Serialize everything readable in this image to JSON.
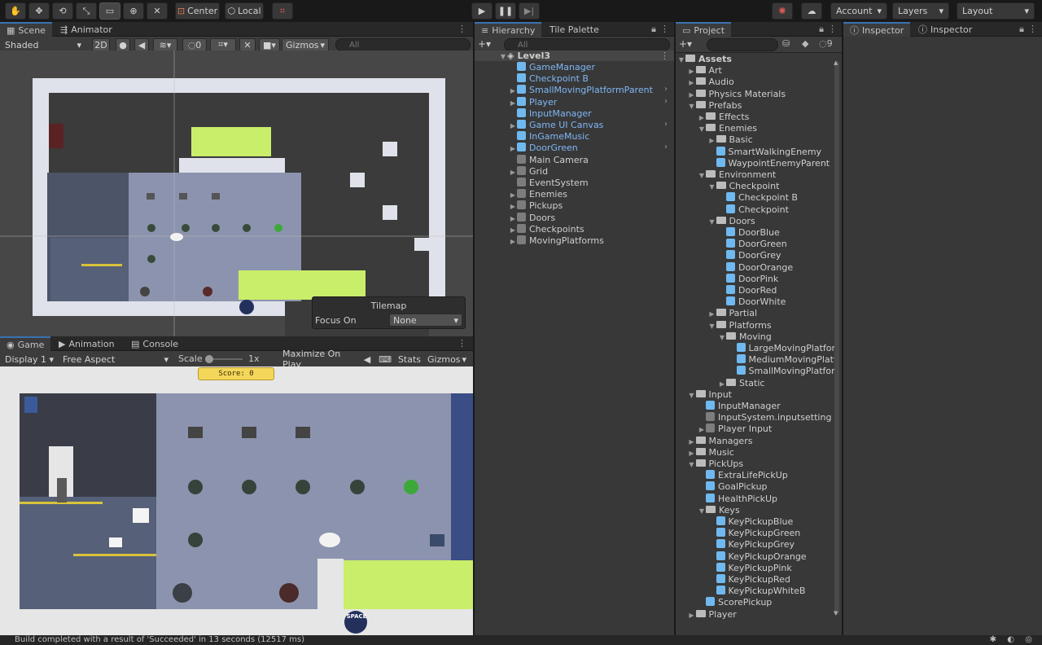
{
  "toolbar": {
    "center_label": "Center",
    "local_label": "Local",
    "account_label": "Account",
    "layers_label": "Layers",
    "layout_label": "Layout"
  },
  "scene": {
    "tabs": [
      "Scene",
      "Animator"
    ],
    "shading": "Shaded",
    "mode_2d": "2D",
    "hidden_count": "0",
    "gizmos": "Gizmos",
    "search_placeholder": "All",
    "overlay_title": "Tilemap",
    "focus_label": "Focus On",
    "focus_value": "None"
  },
  "game": {
    "tabs": [
      "Game",
      "Animation",
      "Console"
    ],
    "display": "Display 1",
    "aspect": "Free Aspect",
    "scale_label": "Scale",
    "scale_value": "1x",
    "maximize": "Maximize On Play",
    "stats": "Stats",
    "gizmos": "Gizmos",
    "score": "Score: 0",
    "badge": "SPACE"
  },
  "hierarchy": {
    "tabs": [
      "Hierarchy",
      "Tile Palette"
    ],
    "search_placeholder": "All",
    "root": "Level3",
    "items": [
      {
        "label": "GameManager",
        "blue": true,
        "arrow": false
      },
      {
        "label": "Checkpoint B",
        "blue": true,
        "arrow": false
      },
      {
        "label": "SmallMovingPlatformParent",
        "blue": true,
        "arrow": true
      },
      {
        "label": "Player",
        "blue": true,
        "arrow": true
      },
      {
        "label": "InputManager",
        "blue": true,
        "arrow": false
      },
      {
        "label": "Game UI Canvas",
        "blue": true,
        "arrow": true
      },
      {
        "label": "InGameMusic",
        "blue": true,
        "arrow": false
      },
      {
        "label": "DoorGreen",
        "blue": true,
        "arrow": true
      },
      {
        "label": "Main Camera",
        "blue": false,
        "arrow": false
      },
      {
        "label": "Grid",
        "blue": false,
        "arrow": true
      },
      {
        "label": "EventSystem",
        "blue": false,
        "arrow": false
      },
      {
        "label": "Enemies",
        "blue": false,
        "arrow": true
      },
      {
        "label": "Pickups",
        "blue": false,
        "arrow": true
      },
      {
        "label": "Doors",
        "blue": false,
        "arrow": true
      },
      {
        "label": "Checkpoints",
        "blue": false,
        "arrow": true
      },
      {
        "label": "MovingPlatforms",
        "blue": false,
        "arrow": true
      }
    ]
  },
  "project": {
    "tab": "Project",
    "hidden_count": "9",
    "items": [
      {
        "label": "Assets",
        "depth": 0,
        "type": "folder",
        "open": true
      },
      {
        "label": "Art",
        "depth": 1,
        "type": "folder",
        "open": false
      },
      {
        "label": "Audio",
        "depth": 1,
        "type": "folder",
        "open": false
      },
      {
        "label": "Physics Materials",
        "depth": 1,
        "type": "folder",
        "open": false
      },
      {
        "label": "Prefabs",
        "depth": 1,
        "type": "folder",
        "open": true
      },
      {
        "label": "Effects",
        "depth": 2,
        "type": "folder",
        "open": false
      },
      {
        "label": "Enemies",
        "depth": 2,
        "type": "folder",
        "open": true
      },
      {
        "label": "Basic",
        "depth": 3,
        "type": "folder",
        "open": false
      },
      {
        "label": "SmartWalkingEnemy",
        "depth": 3,
        "type": "prefab"
      },
      {
        "label": "WaypointEnemyParent",
        "depth": 3,
        "type": "prefab"
      },
      {
        "label": "Environment",
        "depth": 2,
        "type": "folder",
        "open": true
      },
      {
        "label": "Checkpoint",
        "depth": 3,
        "type": "folder",
        "open": true
      },
      {
        "label": "Checkpoint B",
        "depth": 4,
        "type": "prefab"
      },
      {
        "label": "Checkpoint",
        "depth": 4,
        "type": "prefab"
      },
      {
        "label": "Doors",
        "depth": 3,
        "type": "folder",
        "open": true
      },
      {
        "label": "DoorBlue",
        "depth": 4,
        "type": "prefab"
      },
      {
        "label": "DoorGreen",
        "depth": 4,
        "type": "prefab"
      },
      {
        "label": "DoorGrey",
        "depth": 4,
        "type": "prefab"
      },
      {
        "label": "DoorOrange",
        "depth": 4,
        "type": "prefab"
      },
      {
        "label": "DoorPink",
        "depth": 4,
        "type": "prefab"
      },
      {
        "label": "DoorRed",
        "depth": 4,
        "type": "prefab"
      },
      {
        "label": "DoorWhite",
        "depth": 4,
        "type": "prefab"
      },
      {
        "label": "Partial",
        "depth": 3,
        "type": "folder",
        "open": false
      },
      {
        "label": "Platforms",
        "depth": 3,
        "type": "folder",
        "open": true
      },
      {
        "label": "Moving",
        "depth": 4,
        "type": "folder",
        "open": true
      },
      {
        "label": "LargeMovingPlatfor",
        "depth": 5,
        "type": "prefab"
      },
      {
        "label": "MediumMovingPlatf",
        "depth": 5,
        "type": "prefab"
      },
      {
        "label": "SmallMovingPlatfon",
        "depth": 5,
        "type": "prefab"
      },
      {
        "label": "Static",
        "depth": 4,
        "type": "folder",
        "open": false
      },
      {
        "label": "Input",
        "depth": 1,
        "type": "folder",
        "open": true
      },
      {
        "label": "InputManager",
        "depth": 2,
        "type": "prefab"
      },
      {
        "label": "InputSystem.inputsetting",
        "depth": 2,
        "type": "asset"
      },
      {
        "label": "Player Input",
        "depth": 2,
        "type": "asset",
        "arrow": true
      },
      {
        "label": "Managers",
        "depth": 1,
        "type": "folder",
        "open": false
      },
      {
        "label": "Music",
        "depth": 1,
        "type": "folder",
        "open": false
      },
      {
        "label": "PickUps",
        "depth": 1,
        "type": "folder",
        "open": true
      },
      {
        "label": "ExtraLifePickUp",
        "depth": 2,
        "type": "prefab"
      },
      {
        "label": "GoalPickup",
        "depth": 2,
        "type": "prefab"
      },
      {
        "label": "HealthPickUp",
        "depth": 2,
        "type": "prefab"
      },
      {
        "label": "Keys",
        "depth": 2,
        "type": "folder",
        "open": true
      },
      {
        "label": "KeyPickupBlue",
        "depth": 3,
        "type": "prefab"
      },
      {
        "label": "KeyPickupGreen",
        "depth": 3,
        "type": "prefab"
      },
      {
        "label": "KeyPickupGrey",
        "depth": 3,
        "type": "prefab"
      },
      {
        "label": "KeyPickupOrange",
        "depth": 3,
        "type": "prefab"
      },
      {
        "label": "KeyPickupPink",
        "depth": 3,
        "type": "prefab"
      },
      {
        "label": "KeyPickupRed",
        "depth": 3,
        "type": "prefab"
      },
      {
        "label": "KeyPickupWhiteB",
        "depth": 3,
        "type": "prefab"
      },
      {
        "label": "ScorePickup",
        "depth": 2,
        "type": "prefab"
      },
      {
        "label": "Player",
        "depth": 1,
        "type": "folder",
        "open": false
      }
    ]
  },
  "inspector": {
    "tabs": [
      "Inspector",
      "Inspector"
    ]
  },
  "status": {
    "message": "Build completed with a result of 'Succeeded' in 13 seconds (12517 ms)"
  },
  "colors": {
    "accent": "#3a72b0",
    "prefab_blue": "#7fb7f5",
    "slime": "#c9ee6a"
  }
}
